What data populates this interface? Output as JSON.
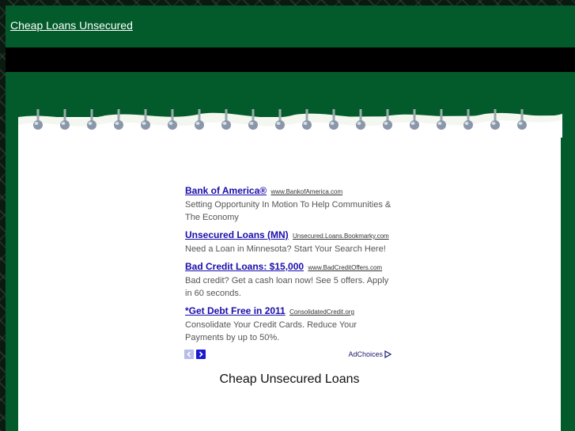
{
  "site": {
    "title": "Cheap Loans Unsecured"
  },
  "ads": [
    {
      "title": "Bank of America®",
      "url": "www.BankofAmerica.com",
      "description": "Setting Opportunity In Motion To Help Communities & The Economy"
    },
    {
      "title": "Unsecured Loans (MN)",
      "url": "Unsecured.Loans.Bookmarky.com",
      "description": "Need a Loan in Minnesota? Start Your Search Here!"
    },
    {
      "title": "Bad Credit Loans: $15,000",
      "url": "www.BadCreditOffers.com",
      "description": "Bad credit? Get a cash loan now! See 5 offers. Apply in 60 seconds."
    },
    {
      "title": "*Get Debt Free in 2011",
      "url": "ConsolidatedCredit.org",
      "description": "Consolidate Your Credit Cards. Reduce Your Payments by up to 50%."
    }
  ],
  "ad_controls": {
    "adchoices_label": "AdChoices",
    "prev_icon": "chevron-left-icon",
    "next_icon": "chevron-right-icon"
  },
  "main": {
    "heading": "Cheap Unsecured Loans"
  },
  "colors": {
    "header_green": "#035b2c",
    "nav_black": "#000000",
    "ad_link": "#1a0dab"
  }
}
